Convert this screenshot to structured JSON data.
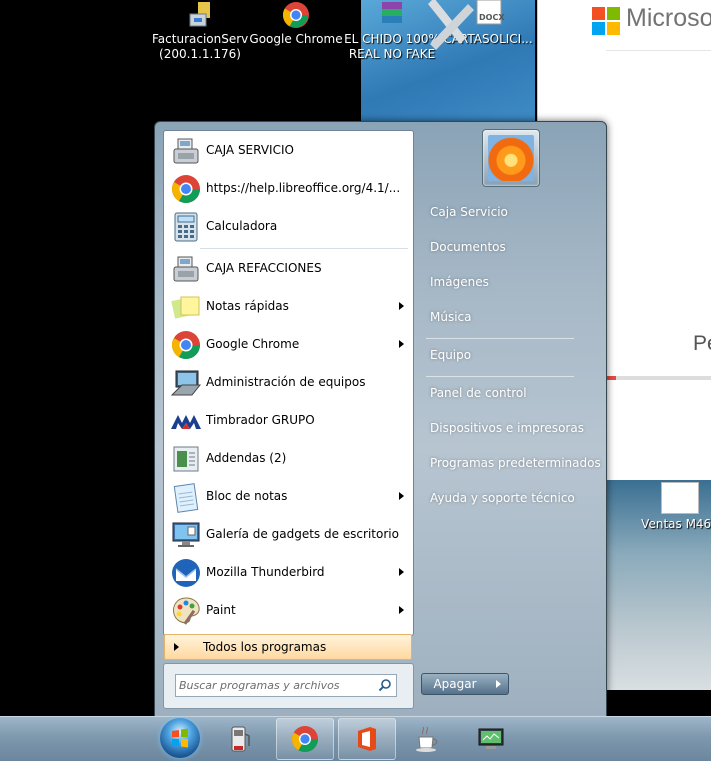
{
  "desktop": {
    "icons": [
      {
        "label": "FacturacionServ\n(200.1.1.176)",
        "icon": "sales-terminal-icon"
      },
      {
        "label": "Google Chrome",
        "icon": "chrome-icon"
      },
      {
        "label": "EL CHIDO 100%\nREAL NO FAKE",
        "icon": "winrar-icon"
      },
      {
        "label": "CARTASOLICI...",
        "icon": "docx-icon"
      }
    ],
    "docx_badge": "DOCX",
    "microsoft_text": "Microsoft",
    "window_text": "Pe",
    "ventas_label": "Ventas M461"
  },
  "start_menu": {
    "programs": [
      {
        "label": "CAJA SERVICIO",
        "icon": "cash-register-icon",
        "submenu": false
      },
      {
        "label": "https://help.libreoffice.org/4.1/...",
        "icon": "chrome-icon",
        "submenu": false
      },
      {
        "label": "Calculadora",
        "icon": "calculator-icon",
        "submenu": false
      },
      {
        "label": "CAJA REFACCIONES",
        "icon": "cash-register-icon",
        "submenu": false
      },
      {
        "label": "Notas rápidas",
        "icon": "sticky-notes-icon",
        "submenu": true
      },
      {
        "label": "Google Chrome",
        "icon": "chrome-icon",
        "submenu": true
      },
      {
        "label": "Administración de equipos",
        "icon": "computer-management-icon",
        "submenu": false
      },
      {
        "label": "Timbrador GRUPO",
        "icon": "timbrador-logo-icon",
        "submenu": false
      },
      {
        "label": "Addendas (2)",
        "icon": "addendas-icon",
        "submenu": false
      },
      {
        "label": "Bloc de notas",
        "icon": "notepad-icon",
        "submenu": true
      },
      {
        "label": "Galería de gadgets de escritorio",
        "icon": "gadgets-icon",
        "submenu": false
      },
      {
        "label": "Mozilla Thunderbird",
        "icon": "thunderbird-icon",
        "submenu": true
      },
      {
        "label": "Paint",
        "icon": "paint-palette-icon",
        "submenu": true
      }
    ],
    "all_programs": "Todos los programas",
    "search_placeholder": "Buscar programas y archivos",
    "right_links": [
      {
        "label": "Caja Servicio"
      },
      {
        "label": "Documentos"
      },
      {
        "label": "Imágenes"
      },
      {
        "label": "Música"
      },
      {
        "label": "Equipo"
      },
      {
        "label": "Panel de control"
      },
      {
        "label": "Dispositivos e impresoras"
      },
      {
        "label": "Programas predeterminados"
      },
      {
        "label": "Ayuda y soporte técnico"
      }
    ],
    "shutdown_label": "Apagar"
  },
  "taskbar": {
    "pinned": [
      "fuel-pump-icon",
      "chrome-icon",
      "office-icon",
      "java-cup-icon",
      "computer-monitor-icon"
    ]
  }
}
